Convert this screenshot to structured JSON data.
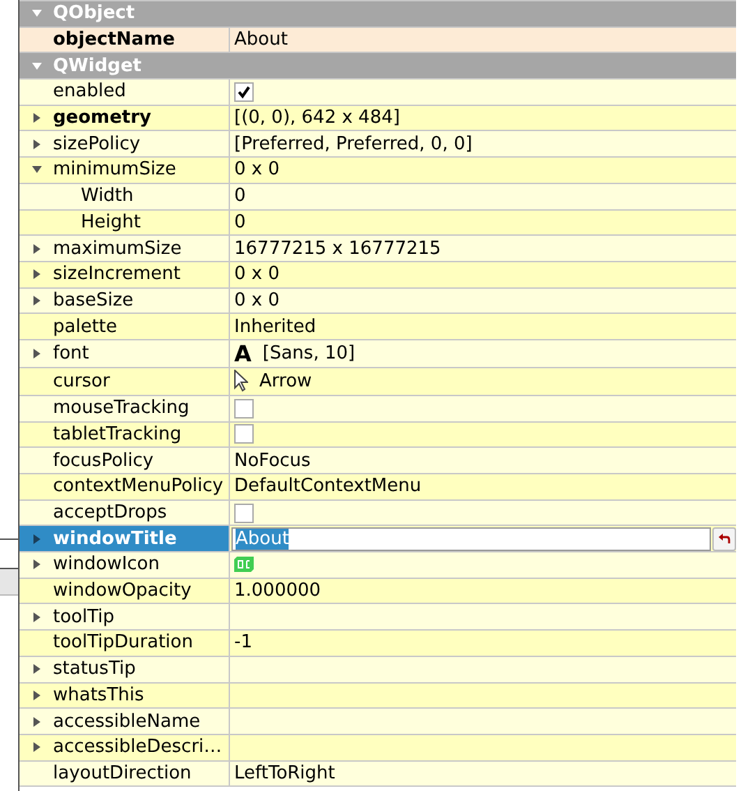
{
  "groups": [
    {
      "name": "QObject",
      "expanded": true,
      "properties": [
        {
          "name": "objectName",
          "bold": true,
          "kind": "text",
          "value": "About",
          "expandable": false,
          "selected": false
        }
      ]
    },
    {
      "name": "QWidget",
      "expanded": true,
      "properties": [
        {
          "name": "enabled",
          "bold": false,
          "kind": "checkbox",
          "checked": true,
          "expandable": false,
          "selected": false
        },
        {
          "name": "geometry",
          "bold": true,
          "kind": "text",
          "value": "[(0, 0), 642 x 484]",
          "expandable": true,
          "expanded": false,
          "selected": false
        },
        {
          "name": "sizePolicy",
          "bold": false,
          "kind": "text",
          "value": "[Preferred, Preferred, 0, 0]",
          "expandable": true,
          "expanded": false,
          "selected": false
        },
        {
          "name": "minimumSize",
          "bold": false,
          "kind": "text",
          "value": "0 x 0",
          "expandable": true,
          "expanded": true,
          "selected": false,
          "children": [
            {
              "name": "Width",
              "bold": false,
              "kind": "text",
              "value": "0",
              "expandable": false,
              "selected": false
            },
            {
              "name": "Height",
              "bold": false,
              "kind": "text",
              "value": "0",
              "expandable": false,
              "selected": false
            }
          ]
        },
        {
          "name": "maximumSize",
          "bold": false,
          "kind": "text",
          "value": "16777215 x 16777215",
          "expandable": true,
          "expanded": false,
          "selected": false
        },
        {
          "name": "sizeIncrement",
          "bold": false,
          "kind": "text",
          "value": "0 x 0",
          "expandable": true,
          "expanded": false,
          "selected": false
        },
        {
          "name": "baseSize",
          "bold": false,
          "kind": "text",
          "value": "0 x 0",
          "expandable": true,
          "expanded": false,
          "selected": false
        },
        {
          "name": "palette",
          "bold": false,
          "kind": "text",
          "value": "Inherited",
          "expandable": false,
          "selected": false
        },
        {
          "name": "font",
          "bold": false,
          "kind": "font",
          "glyph": "A",
          "value": "[Sans, 10]",
          "expandable": true,
          "expanded": false,
          "selected": false
        },
        {
          "name": "cursor",
          "bold": false,
          "kind": "cursor",
          "value": "Arrow",
          "expandable": false,
          "selected": false
        },
        {
          "name": "mouseTracking",
          "bold": false,
          "kind": "checkbox",
          "checked": false,
          "expandable": false,
          "selected": false
        },
        {
          "name": "tabletTracking",
          "bold": false,
          "kind": "checkbox",
          "checked": false,
          "expandable": false,
          "selected": false
        },
        {
          "name": "focusPolicy",
          "bold": false,
          "kind": "text",
          "value": "NoFocus",
          "expandable": false,
          "selected": false
        },
        {
          "name": "contextMenuPolicy",
          "bold": false,
          "kind": "text",
          "value": "DefaultContextMenu",
          "expandable": false,
          "selected": false
        },
        {
          "name": "acceptDrops",
          "bold": false,
          "kind": "checkbox",
          "checked": false,
          "expandable": false,
          "selected": false
        },
        {
          "name": "windowTitle",
          "bold": true,
          "kind": "editor",
          "value": "About",
          "expandable": true,
          "expanded": false,
          "selected": true
        },
        {
          "name": "windowIcon",
          "bold": false,
          "kind": "icon",
          "expandable": true,
          "expanded": false,
          "selected": false
        },
        {
          "name": "windowOpacity",
          "bold": false,
          "kind": "text",
          "value": "1.000000",
          "expandable": false,
          "selected": false
        },
        {
          "name": "toolTip",
          "bold": false,
          "kind": "text",
          "expandable": true,
          "expanded": false,
          "selected": false
        },
        {
          "name": "toolTipDuration",
          "bold": false,
          "kind": "text",
          "value": "-1",
          "expandable": false,
          "selected": false
        },
        {
          "name": "statusTip",
          "bold": false,
          "kind": "text",
          "expandable": true,
          "expanded": false,
          "selected": false
        },
        {
          "name": "whatsThis",
          "bold": false,
          "kind": "text",
          "expandable": true,
          "expanded": false,
          "selected": false
        },
        {
          "name": "accessibleName",
          "bold": false,
          "kind": "text",
          "expandable": true,
          "expanded": false,
          "selected": false
        },
        {
          "name": "accessibleDescri…",
          "bold": false,
          "kind": "text",
          "expandable": true,
          "expanded": false,
          "selected": false
        },
        {
          "name": "layoutDirection",
          "bold": false,
          "kind": "text",
          "value": "LeftToRight",
          "expandable": false,
          "selected": false
        }
      ]
    }
  ]
}
